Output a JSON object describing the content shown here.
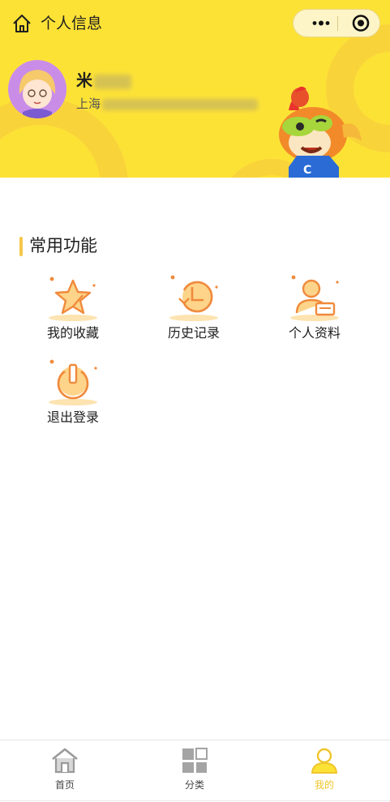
{
  "nav": {
    "title": "个人信息"
  },
  "capsule": {
    "more_icon": "more-dots-icon",
    "close_icon": "close-miniprogram-icon"
  },
  "user": {
    "name_visible": "米",
    "location_visible": "上海"
  },
  "section": {
    "title": "常用功能"
  },
  "functions": [
    {
      "label": "我的收藏",
      "icon": "star-icon"
    },
    {
      "label": "历史记录",
      "icon": "clock-history-icon"
    },
    {
      "label": "个人资料",
      "icon": "profile-card-icon"
    },
    {
      "label": "退出登录",
      "icon": "power-icon"
    }
  ],
  "tabs": [
    {
      "label": "首页",
      "icon": "home-icon",
      "active": false
    },
    {
      "label": "分类",
      "icon": "category-grid-icon",
      "active": false
    },
    {
      "label": "我的",
      "icon": "user-icon",
      "active": true
    }
  ],
  "colors": {
    "header_bg": "#fde236",
    "accent": "#f5c74a",
    "icon_orange": "#f08a3c",
    "active_tab": "#f0c52c"
  }
}
